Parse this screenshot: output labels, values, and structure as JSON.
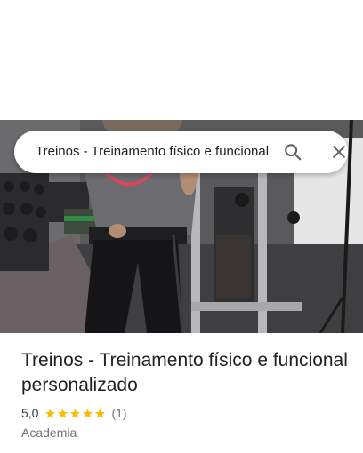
{
  "search": {
    "query": "Treinos - Treinamento físico e funcional personalizado"
  },
  "place": {
    "title": "Treinos - Treinamento físico e funcional personalizado",
    "rating": "5,0",
    "stars": 5,
    "review_count": "(1)",
    "category": "Academia"
  },
  "colors": {
    "star": "#fbbc04",
    "text_primary": "#202124",
    "text_secondary": "#70757a"
  },
  "icons": {
    "search": "search-icon",
    "close": "close-icon",
    "star": "star-icon"
  }
}
